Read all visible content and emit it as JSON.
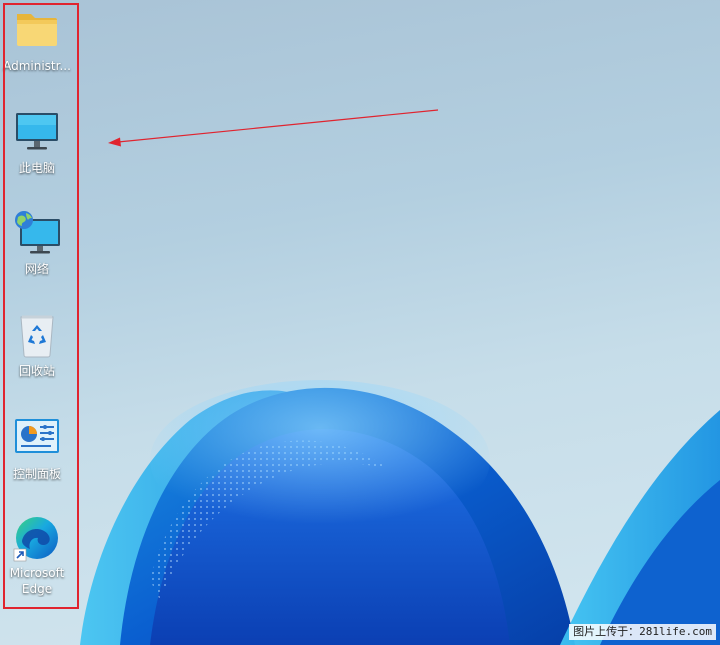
{
  "desktop": {
    "icons": [
      {
        "id": "folder",
        "label": "Administr..."
      },
      {
        "id": "this-pc",
        "label": "此电脑"
      },
      {
        "id": "network",
        "label": "网络"
      },
      {
        "id": "recycle-bin",
        "label": "回收站"
      },
      {
        "id": "control-panel",
        "label": "控制面板"
      },
      {
        "id": "edge",
        "label": "Microsoft Edge"
      }
    ]
  },
  "annotation": {
    "box_color": "#e0242f",
    "arrow_color": "#e0242f"
  },
  "watermark": {
    "text": "图片上传于：281life.com"
  }
}
